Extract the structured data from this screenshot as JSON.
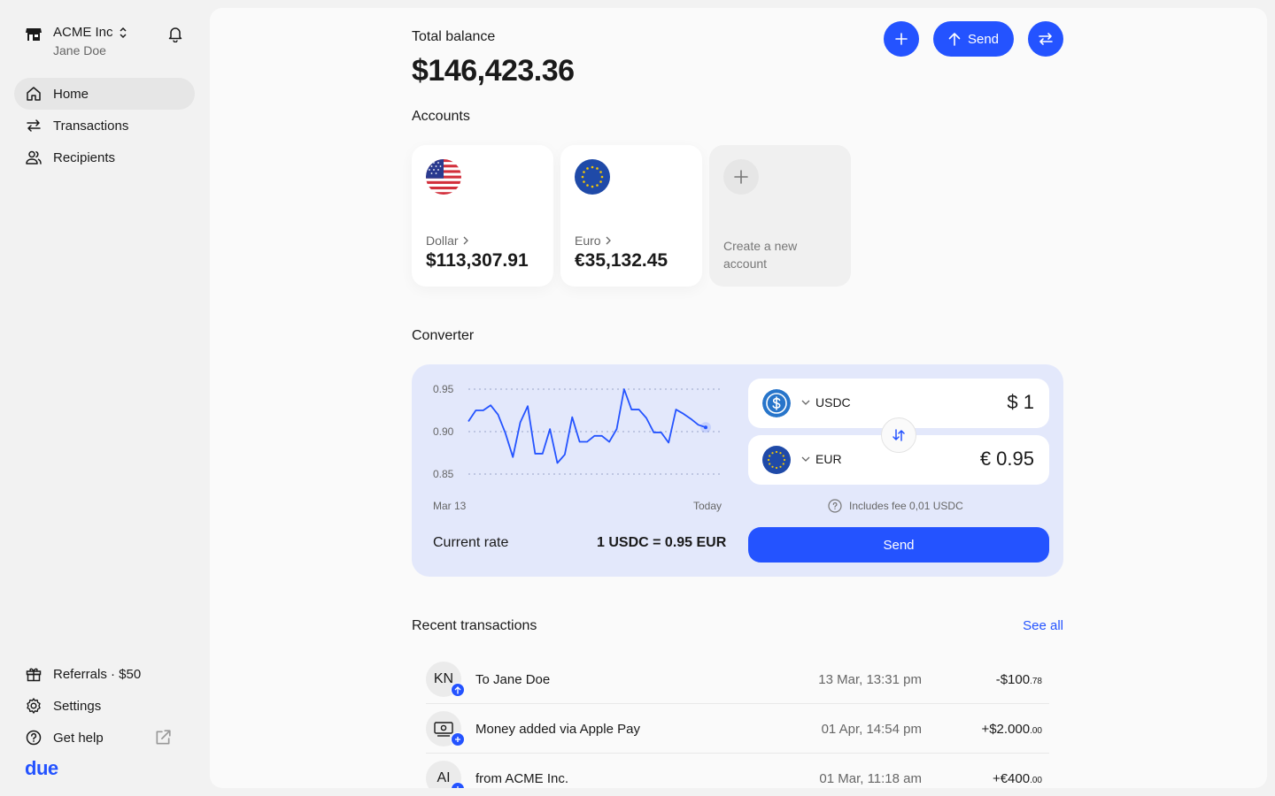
{
  "sidebar": {
    "org_name": "ACME Inc",
    "user_name": "Jane Doe",
    "nav": [
      {
        "label": "Home",
        "icon": "home-icon",
        "active": true
      },
      {
        "label": "Transactions",
        "icon": "transfer-arrows-icon"
      },
      {
        "label": "Recipients",
        "icon": "people-icon"
      }
    ],
    "bottom": [
      {
        "label": "Referrals · $50",
        "icon": "gift-icon"
      },
      {
        "label": "Settings",
        "icon": "gear-icon"
      },
      {
        "label": "Get help",
        "icon": "help-icon"
      }
    ],
    "logo": "due"
  },
  "header": {
    "total_label": "Total balance",
    "total_value": "$146,423.36",
    "send_label": "Send"
  },
  "accounts": {
    "title": "Accounts",
    "items": [
      {
        "name": "Dollar",
        "amount": "$113,307.91",
        "flag": "us-flag-icon"
      },
      {
        "name": "Euro",
        "amount": "€35,132.45",
        "flag": "eu-flag-icon"
      }
    ],
    "create_label": "Create a new account"
  },
  "converter": {
    "title": "Converter",
    "rate_label": "Current rate",
    "rate_value": "1 USDC = 0.95 EUR",
    "from": {
      "code": "USDC",
      "amount": "$ 1"
    },
    "to": {
      "code": "EUR",
      "amount": "€ 0.95"
    },
    "fee": "Includes fee 0,01 USDC",
    "send_label": "Send"
  },
  "chart_data": {
    "type": "line",
    "x_start_label": "Mar 13",
    "x_end_label": "Today",
    "y_ticks": [
      "0.95",
      "0.90",
      "0.85"
    ],
    "ylim": [
      0.85,
      0.95
    ],
    "grid": true,
    "series": [
      {
        "values": [
          0.912,
          0.925,
          0.925,
          0.931,
          0.92,
          0.898,
          0.87,
          0.911,
          0.93,
          0.874,
          0.874,
          0.903,
          0.863,
          0.873,
          0.917,
          0.888,
          0.888,
          0.895,
          0.895,
          0.888,
          0.903,
          0.95,
          0.926,
          0.926,
          0.916,
          0.899,
          0.899,
          0.887,
          0.926,
          0.921,
          0.915,
          0.908,
          0.905
        ]
      }
    ]
  },
  "transactions": {
    "title": "Recent transactions",
    "see_all": "See all",
    "items": [
      {
        "avatar": "KN",
        "desc": "To Jane Doe",
        "date": "13 Mar, 13:31 pm",
        "amount_main": "-$100",
        "amount_cents": ".78",
        "badge": "arrow-up-icon"
      },
      {
        "avatar": "",
        "avatar_icon": "cash-icon",
        "desc": "Money added via Apple Pay",
        "date": "01 Apr, 14:54 pm",
        "amount_main": "+$2.000",
        "amount_cents": ".00",
        "badge": "plus-icon"
      },
      {
        "avatar": "AI",
        "desc": "from ACME Inc.",
        "date": "01 Mar, 11:18 am",
        "amount_main": "+€400",
        "amount_cents": ".00",
        "badge": "plus-icon"
      }
    ]
  }
}
